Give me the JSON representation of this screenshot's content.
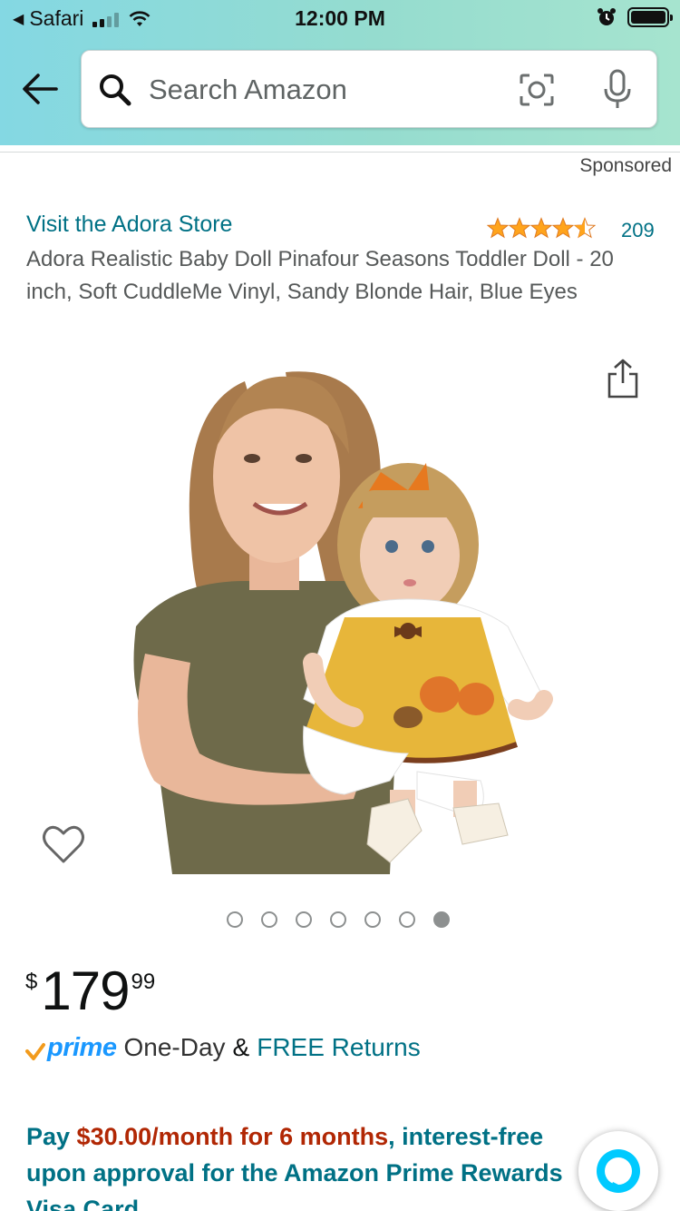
{
  "status_bar": {
    "back_app": "Safari",
    "time": "12:00 PM"
  },
  "header": {
    "search_placeholder": "Search Amazon",
    "icons": [
      "back-arrow-icon",
      "search-icon",
      "camera-icon",
      "mic-icon"
    ]
  },
  "product": {
    "sponsored_label": "Sponsored",
    "store_link": "Visit the Adora Store",
    "rating_stars": 4.5,
    "rating_count": "209",
    "title": "Adora Realistic Baby Doll Pinafour Seasons Toddler Doll - 20 inch, Soft CuddleMe Vinyl, Sandy Blonde Hair, Blue Eyes",
    "image_count": 7,
    "active_image_index": 6
  },
  "price": {
    "symbol": "$",
    "whole": "179",
    "fraction": "99"
  },
  "delivery": {
    "prime_label": "prime",
    "one_day": "One-Day",
    "ampersand": "&",
    "free_returns": "FREE Returns"
  },
  "promo": {
    "line1_prefix": "Pay ",
    "line1_amount": "$30.00/month for 6 months",
    "line1_suffix": ", interest-free",
    "line2": "upon approval for the Amazon Prime Rewards",
    "line3": "Visa Card"
  },
  "colors": {
    "header_gradient_start": "#84d8e3",
    "header_gradient_end": "#a6e4cf",
    "link": "#007185",
    "star": "#ffa41c",
    "promo_amount": "#b12704",
    "prime": "#1a98ff",
    "alexa": "#00caff"
  }
}
